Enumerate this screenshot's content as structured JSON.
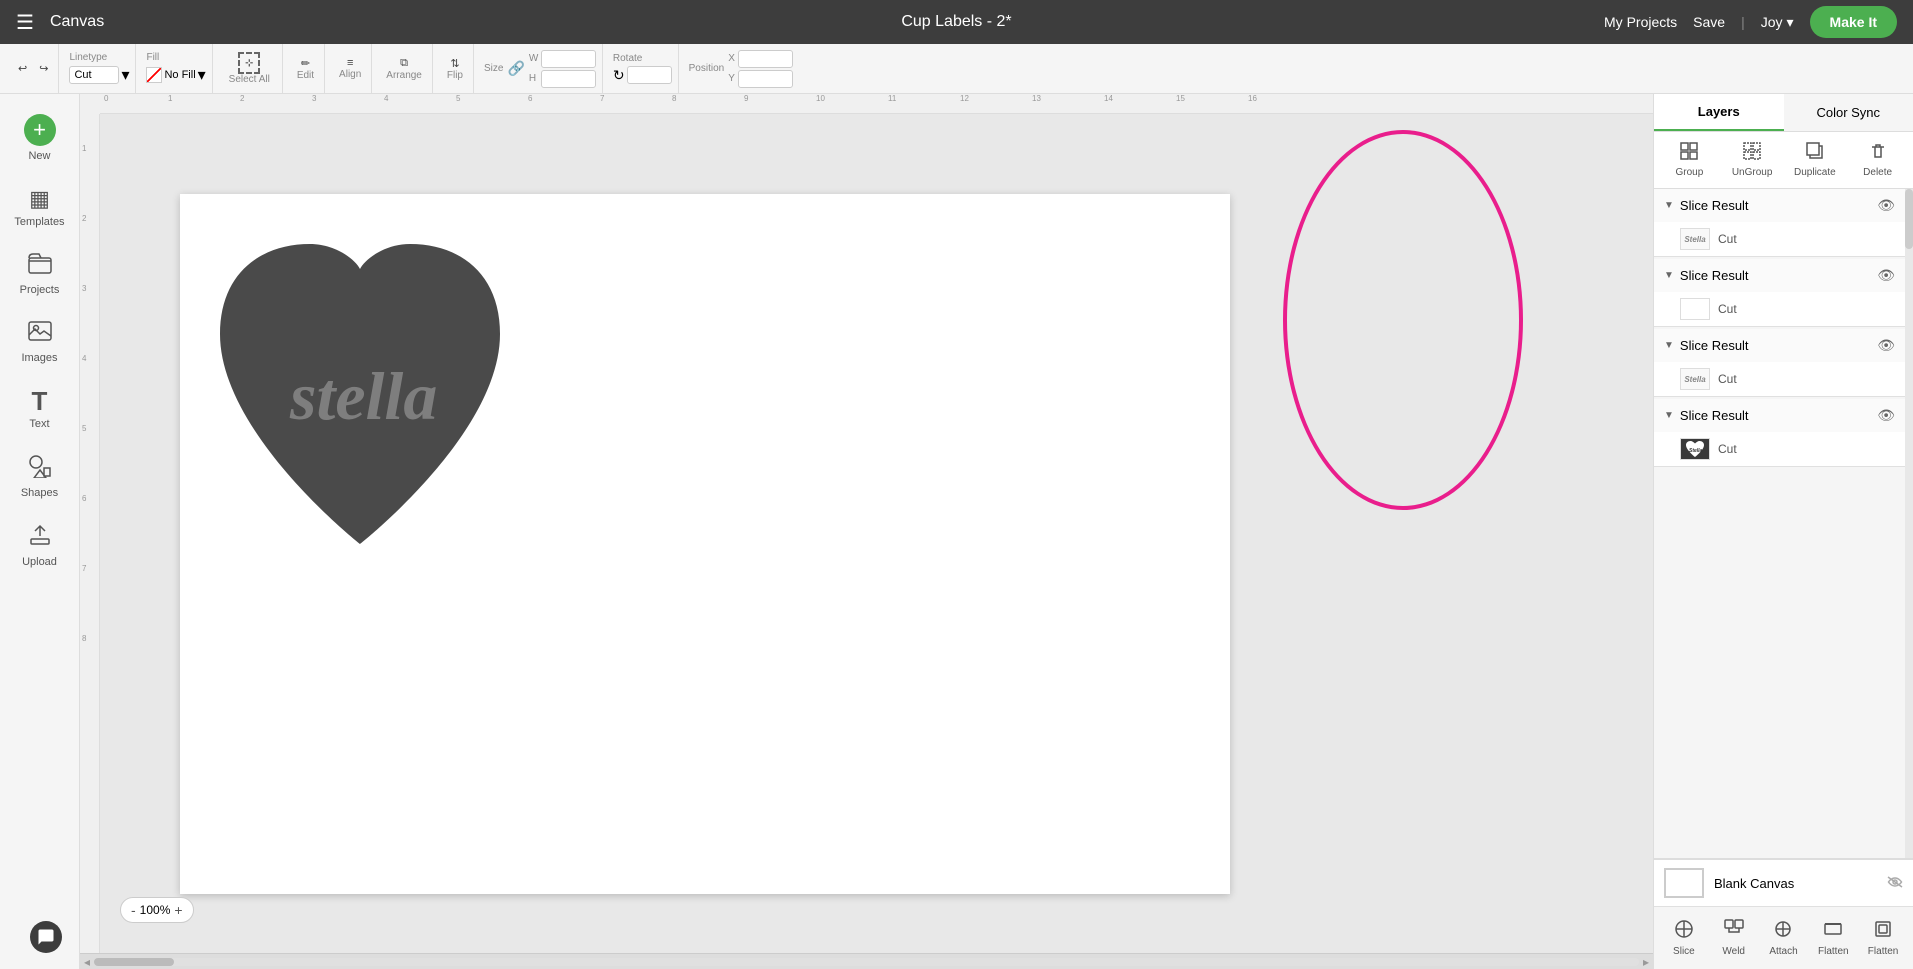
{
  "header": {
    "menu_label": "☰",
    "app_name": "Canvas",
    "title": "Cup Labels - 2*",
    "my_projects": "My Projects",
    "save": "Save",
    "divider": "|",
    "user": "Joy",
    "user_chevron": "▾",
    "make_it": "Make It"
  },
  "toolbar": {
    "undo_label": "↩",
    "redo_label": "↪",
    "linetype_label": "Linetype",
    "linetype_value": "Cut",
    "linetype_chevron": "▾",
    "fill_label": "Fill",
    "fill_value": "No Fill",
    "fill_chevron": "▾",
    "fill_color": "#ff0000",
    "select_all_label": "Select All",
    "edit_label": "Edit",
    "align_label": "Align",
    "arrange_label": "Arrange",
    "flip_label": "Flip",
    "size_label": "Size",
    "w_label": "W",
    "h_label": "H",
    "rotate_label": "Rotate",
    "position_label": "Position",
    "x_label": "X",
    "y_label": "Y"
  },
  "sidebar": {
    "items": [
      {
        "label": "New",
        "icon": "＋"
      },
      {
        "label": "Templates",
        "icon": "▦"
      },
      {
        "label": "Projects",
        "icon": "📁"
      },
      {
        "label": "Images",
        "icon": "🖼"
      },
      {
        "label": "Text",
        "icon": "T"
      },
      {
        "label": "Shapes",
        "icon": "⬡"
      },
      {
        "label": "Upload",
        "icon": "↑"
      }
    ]
  },
  "canvas": {
    "zoom_level": "100%",
    "zoom_in": "+",
    "zoom_out": "-",
    "ruler_numbers": [
      "0",
      "1",
      "2",
      "3",
      "4",
      "5",
      "6",
      "7",
      "8",
      "9",
      "10",
      "11",
      "12",
      "13",
      "14",
      "15",
      "16"
    ]
  },
  "right_panel": {
    "tabs": [
      {
        "label": "Layers",
        "active": true
      },
      {
        "label": "Color Sync",
        "active": false
      }
    ],
    "toolbar_buttons": [
      {
        "label": "Group",
        "icon": "⊞"
      },
      {
        "label": "UnGroup",
        "icon": "⊟"
      },
      {
        "label": "Duplicate",
        "icon": "⧉"
      },
      {
        "label": "Delete",
        "icon": "🗑"
      }
    ],
    "layers": [
      {
        "title": "Slice Result",
        "items": [
          {
            "thumb_type": "text",
            "thumb_label": "Stella",
            "cut_label": "Cut"
          }
        ]
      },
      {
        "title": "Slice Result",
        "items": [
          {
            "thumb_type": "empty",
            "thumb_label": "",
            "cut_label": "Cut"
          }
        ]
      },
      {
        "title": "Slice Result",
        "items": [
          {
            "thumb_type": "text",
            "thumb_label": "Stella",
            "cut_label": "Cut"
          }
        ]
      },
      {
        "title": "Slice Result",
        "items": [
          {
            "thumb_type": "heart",
            "thumb_label": "❤",
            "cut_label": "Cut"
          }
        ]
      }
    ],
    "bottom": {
      "blank_canvas_label": "Blank Canvas",
      "bottom_buttons": [
        {
          "label": "Slice",
          "icon": "✂"
        },
        {
          "label": "Weld",
          "icon": "⊕"
        },
        {
          "label": "Attach",
          "icon": "📌"
        },
        {
          "label": "Flatten",
          "icon": "⬛"
        },
        {
          "label": "Flatten",
          "icon": "◱"
        }
      ]
    }
  }
}
